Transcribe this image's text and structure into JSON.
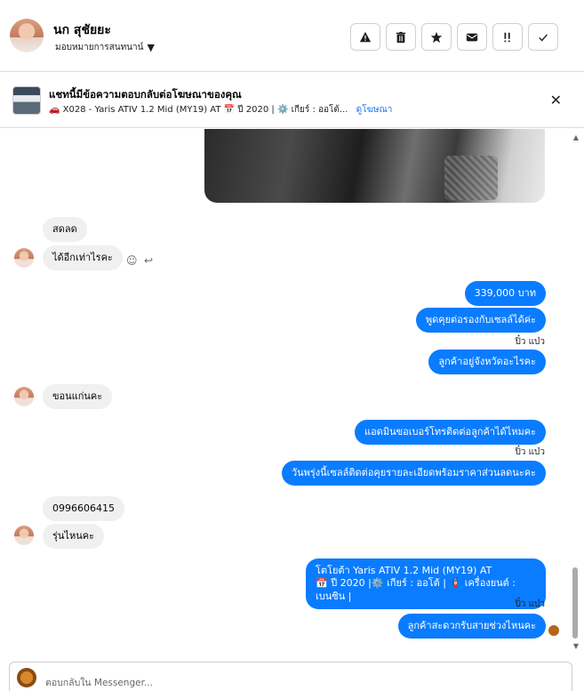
{
  "header": {
    "name": "นก สุชัยยะ",
    "assign_label": "มอบหมายการสนทนาน์",
    "actions": [
      "report",
      "delete",
      "star",
      "mark-unread",
      "spam",
      "done"
    ]
  },
  "ad": {
    "title": "แชทนี้มีข้อความตอบกลับต่อโฆษณาของคุณ",
    "subtitle": "🚗 X028 - Yaris ATIV 1.2 Mid (MY19) AT 📅 ปี 2020 | ⚙️ เกียร์ : ออโต้...",
    "link": "ดูโฆษณา"
  },
  "messages": {
    "m1": "สดลด",
    "m2": "ได้อีกเท่าไรคะ",
    "m3": "339,000 บาท",
    "m4": "พูดคุยต่อรองกับเซลล์ได้ค่ะ",
    "seen1": "ปิ๋ว แบ๋ว",
    "m5": "ลูกค้าอยู่จังหวัดอะไรคะ",
    "m6": "ขอนแก่นคะ",
    "m7": "แอดมินขอเบอร์โทรติดต่อลูกค้าได้ไหมคะ",
    "seen2": "ปิ๋ว แบ๋ว",
    "m8": "วันพรุ่งนี้เซลล์ติดต่อคุยรายละเอียดพร้อมราคาส่วนลดนะคะ",
    "m9": "0996606415",
    "m10": "รุ่นไหนคะ",
    "m11_line1": "โตโยต้า Yaris ATIV 1.2 Mid (MY19) AT",
    "m11_line2": "📅 ปี 2020 |⚙️ เกียร์ : ออโต้ | 🧯 เครื่องยนต์ : เบนซิน |",
    "seen3": "ปิ๋ว แบ๋ว",
    "m12": "ลูกค้าสะดวกรับสายช่วงไหนคะ"
  },
  "composer": {
    "placeholder": "ตอบกลับใน Messenger..."
  }
}
